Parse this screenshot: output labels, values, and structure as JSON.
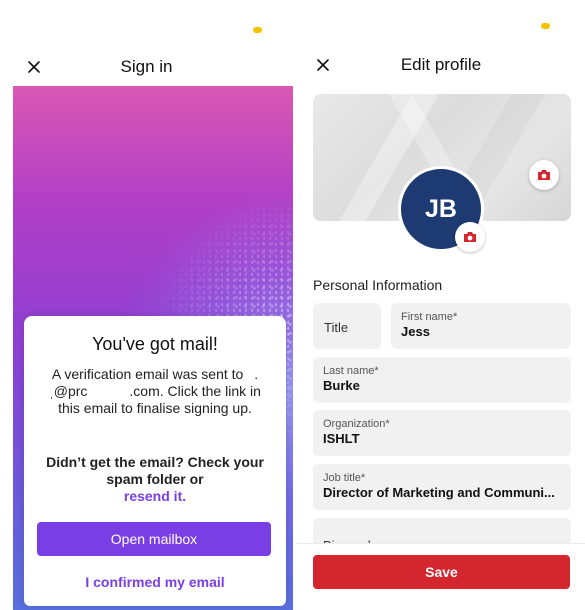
{
  "signin": {
    "title": "Sign in",
    "card": {
      "heading": "You've got mail!",
      "message": "A verification email was sent to  .ˌ@prc      .com. Click the link in this email to finalise signing up.",
      "question": "Didn’t get the email? Check your spam folder or",
      "resend_link": "resend it.",
      "open_mailbox_label": "Open mailbox",
      "confirmed_link": "I confirmed my email"
    }
  },
  "profile": {
    "title": "Edit profile",
    "avatar_initials": "JB",
    "section_title": "Personal Information",
    "fields": {
      "title_placeholder": "Title",
      "first_name": {
        "label": "First name*",
        "value": "Jess"
      },
      "last_name": {
        "label": "Last name*",
        "value": "Burke"
      },
      "organization": {
        "label": "Organization*",
        "value": "ISHLT"
      },
      "job_title": {
        "label": "Job title*",
        "value": "Director of Marketing and Communi..."
      },
      "biography": {
        "label": "Biography"
      }
    },
    "save_label": "Save"
  },
  "colors": {
    "accent_purple": "#7a3fe4",
    "save_red": "#d3262e",
    "avatar_navy": "#1e3a72",
    "status_yellow": "#f5c400"
  },
  "icons": [
    "close-icon",
    "camera-icon"
  ]
}
